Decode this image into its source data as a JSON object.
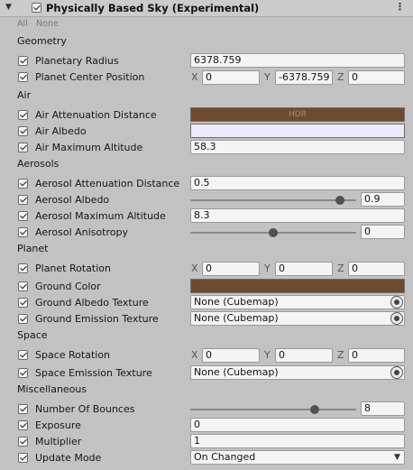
{
  "component": {
    "title": "Physically Based Sky (Experimental)",
    "enabled": true,
    "menu_icon": "kebab-menu-icon",
    "fold_icon": "foldout-arrow-icon"
  },
  "filter": {
    "all": "All",
    "none": "None"
  },
  "sections": {
    "geometry": "Geometry",
    "air": "Air",
    "aerosols": "Aerosols",
    "planet": "Planet",
    "space": "Space",
    "misc": "Miscellaneous"
  },
  "geometry": {
    "planetary_radius": {
      "label": "Planetary Radius",
      "value": "6378.759"
    },
    "planet_center": {
      "label": "Planet Center Position",
      "x_label": "X",
      "x": "0",
      "y_label": "Y",
      "y": "-6378.759",
      "z_label": "Z",
      "z": "0"
    }
  },
  "air": {
    "attenuation": {
      "label": "Air Attenuation Distance",
      "badge": "HDR",
      "color": "#6e4a2e"
    },
    "albedo": {
      "label": "Air Albedo",
      "color": "#ecebfb"
    },
    "max_altitude": {
      "label": "Air Maximum Altitude",
      "value": "58.3"
    }
  },
  "aerosols": {
    "attenuation": {
      "label": "Aerosol Attenuation Distance",
      "value": "0.5"
    },
    "albedo": {
      "label": "Aerosol Albedo",
      "value": "0.9",
      "slider_fraction": 0.9
    },
    "max_altitude": {
      "label": "Aerosol Maximum Altitude",
      "value": "8.3"
    },
    "anisotropy": {
      "label": "Aerosol Anisotropy",
      "value": "0",
      "slider_fraction": 0.5
    }
  },
  "planet": {
    "rotation": {
      "label": "Planet Rotation",
      "x_label": "X",
      "x": "0",
      "y_label": "Y",
      "y": "0",
      "z_label": "Z",
      "z": "0"
    },
    "ground_color": {
      "label": "Ground Color",
      "color": "#6e4a2e"
    },
    "ground_albedo_texture": {
      "label": "Ground Albedo Texture",
      "value": "None (Cubemap)"
    },
    "ground_emission_texture": {
      "label": "Ground Emission Texture",
      "value": "None (Cubemap)"
    }
  },
  "space": {
    "rotation": {
      "label": "Space Rotation",
      "x_label": "X",
      "x": "0",
      "y_label": "Y",
      "y": "0",
      "z_label": "Z",
      "z": "0"
    },
    "emission_texture": {
      "label": "Space Emission Texture",
      "value": "None (Cubemap)"
    }
  },
  "misc": {
    "bounces": {
      "label": "Number Of Bounces",
      "value": "8",
      "slider_fraction": 0.75
    },
    "exposure": {
      "label": "Exposure",
      "value": "0"
    },
    "multiplier": {
      "label": "Multiplier",
      "value": "1"
    },
    "update_mode": {
      "label": "Update Mode",
      "value": "On Changed"
    }
  }
}
